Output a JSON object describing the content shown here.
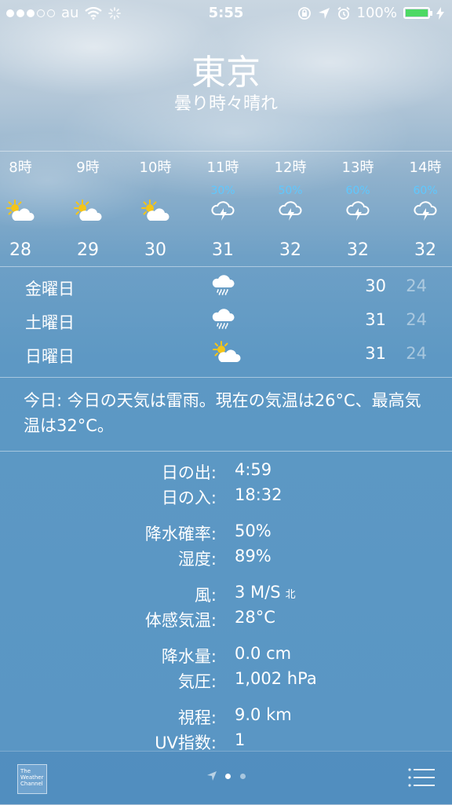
{
  "status_bar": {
    "carrier": "au",
    "time": "5:55",
    "battery_pct": "100%",
    "battery_level": 1.0,
    "signal_bars_filled": 3,
    "signal_bars_total": 5
  },
  "location": {
    "city": "東京",
    "condition": "曇り時々晴れ"
  },
  "hourly": [
    {
      "time": "8時",
      "pop": "",
      "icon": "partly-sunny-icon",
      "temp": "28"
    },
    {
      "time": "9時",
      "pop": "",
      "icon": "partly-sunny-icon",
      "temp": "29"
    },
    {
      "time": "10時",
      "pop": "",
      "icon": "partly-sunny-icon",
      "temp": "30"
    },
    {
      "time": "11時",
      "pop": "30%",
      "icon": "thunderstorm-icon",
      "temp": "31"
    },
    {
      "time": "12時",
      "pop": "50%",
      "icon": "thunderstorm-icon",
      "temp": "32"
    },
    {
      "time": "13時",
      "pop": "60%",
      "icon": "thunderstorm-icon",
      "temp": "32"
    },
    {
      "time": "14時",
      "pop": "60%",
      "icon": "thunderstorm-icon",
      "temp": "32"
    }
  ],
  "daily": [
    {
      "day": "金曜日",
      "icon": "rain-cloud-icon",
      "high": "30",
      "low": "24"
    },
    {
      "day": "土曜日",
      "icon": "rain-cloud-icon",
      "high": "31",
      "low": "24"
    },
    {
      "day": "日曜日",
      "icon": "partly-sunny-icon",
      "high": "31",
      "low": "24"
    }
  ],
  "summary": "今日: 今日の天気は雷雨。現在の気温は26°C、最高気温は32°C。",
  "details": [
    {
      "label": "日の出:",
      "value": "4:59"
    },
    {
      "label": "日の入:",
      "value": "18:32"
    },
    {
      "label": "降水確率:",
      "value": "50%"
    },
    {
      "label": "湿度:",
      "value": "89%"
    },
    {
      "label": "風:",
      "value": "3 M/S",
      "extra": "北"
    },
    {
      "label": "体感気温:",
      "value": "28°C"
    },
    {
      "label": "降水量:",
      "value": "0.0 cm"
    },
    {
      "label": "気圧:",
      "value": "1,002 hPa"
    },
    {
      "label": "視程:",
      "value": "9.0 km"
    },
    {
      "label": "UV指数:",
      "value": "1"
    }
  ],
  "footer": {
    "brand_lines": [
      "The",
      "Weather",
      "Channel"
    ],
    "pages_total": 2,
    "current_page": 1
  },
  "colors": {
    "pop_text": "#5ec8ff",
    "battery_fill": "#4cd964",
    "sun": "#f5c518"
  }
}
